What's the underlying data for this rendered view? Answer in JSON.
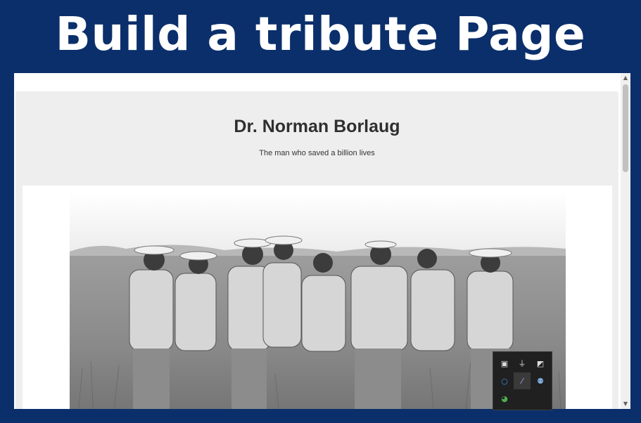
{
  "banner": {
    "title": "Build a tribute Page"
  },
  "page": {
    "heading": "Dr. Norman Borlaug",
    "subheading": "The man who saved a billion lives"
  },
  "photo": {
    "alt": "Norman Borlaug with colleagues in a wheat field"
  },
  "scrollbar": {
    "up": "▲",
    "down": "▼"
  },
  "tray": {
    "icons": [
      {
        "name": "monitor-icon",
        "glyph": "▣"
      },
      {
        "name": "usb-icon",
        "glyph": "⏚"
      },
      {
        "name": "shield-icon",
        "glyph": "◩"
      },
      {
        "name": "circle-icon",
        "glyph": "○"
      },
      {
        "name": "feather-icon",
        "glyph": "⁄"
      },
      {
        "name": "people-icon",
        "glyph": "⚉"
      },
      {
        "name": "globe-icon",
        "glyph": "◕"
      }
    ]
  }
}
